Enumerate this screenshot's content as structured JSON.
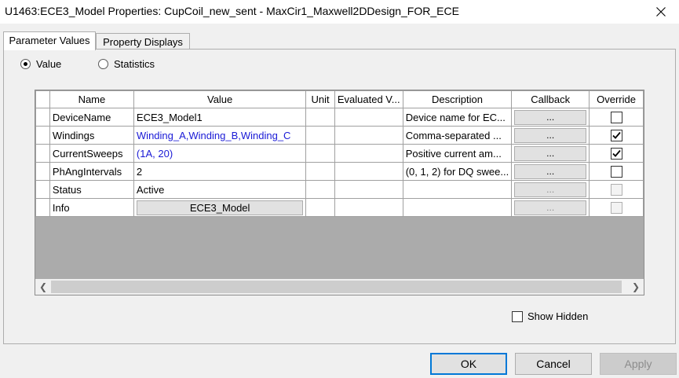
{
  "window": {
    "title": "U1463:ECE3_Model Properties: CupCoil_new_sent - MaxCir1_Maxwell2DDesign_FOR_ECE"
  },
  "tabs": [
    {
      "label": "Parameter Values",
      "active": true
    },
    {
      "label": "Property Displays",
      "active": false
    }
  ],
  "view_mode": {
    "value_label": "Value",
    "statistics_label": "Statistics",
    "selected": "value"
  },
  "grid": {
    "columns": [
      "Name",
      "Value",
      "Unit",
      "Evaluated V...",
      "Description",
      "Callback",
      "Override"
    ],
    "rows": [
      {
        "name": "DeviceName",
        "value": "ECE3_Model1",
        "value_color": "#000000",
        "unit": "",
        "evaluated": "",
        "description": "Device name for EC...",
        "callback": "...",
        "callback_enabled": true,
        "override": false,
        "override_enabled": true
      },
      {
        "name": "Windings",
        "value": "Winding_A,Winding_B,Winding_C",
        "value_color": "#1a1ad6",
        "unit": "",
        "evaluated": "",
        "description": "Comma-separated ...",
        "callback": "...",
        "callback_enabled": true,
        "override": true,
        "override_enabled": true
      },
      {
        "name": "CurrentSweeps",
        "value": "(1A, 20)",
        "value_color": "#1a1ad6",
        "unit": "",
        "evaluated": "",
        "description": "Positive current am...",
        "callback": "...",
        "callback_enabled": true,
        "override": true,
        "override_enabled": true
      },
      {
        "name": "PhAngIntervals",
        "value": "2",
        "value_color": "#000000",
        "unit": "",
        "evaluated": "",
        "description": "(0, 1, 2) for DQ swee...",
        "callback": "...",
        "callback_enabled": true,
        "override": false,
        "override_enabled": true
      },
      {
        "name": "Status",
        "value": "Active",
        "value_color": "#000000",
        "unit": "",
        "evaluated": "",
        "description": "",
        "callback": "...",
        "callback_enabled": false,
        "override": false,
        "override_enabled": false
      },
      {
        "name": "Info",
        "value_button": "ECE3_Model",
        "unit": "",
        "evaluated": "",
        "description": "",
        "callback": "...",
        "callback_enabled": false,
        "override": false,
        "override_enabled": false
      }
    ]
  },
  "show_hidden": {
    "label": "Show Hidden",
    "checked": false
  },
  "buttons": {
    "ok": "OK",
    "cancel": "Cancel",
    "apply": "Apply"
  }
}
